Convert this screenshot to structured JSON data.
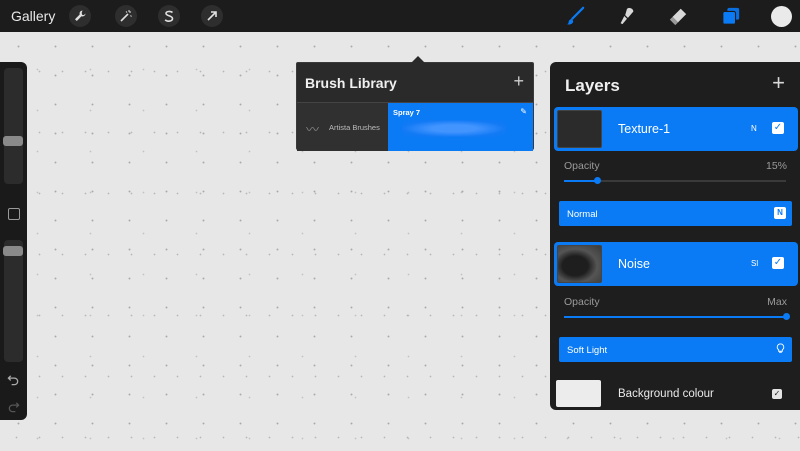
{
  "topbar": {
    "gallery_label": "Gallery",
    "left_actions": [
      "wrench-icon",
      "magic-wand-icon",
      "selection-s-icon",
      "transform-arrow-icon"
    ],
    "right_tools": [
      "brush-icon",
      "smudge-icon",
      "eraser-icon",
      "layers-icon"
    ],
    "active_tool": "brush",
    "current_color": "#eaeaea",
    "accent_color": "#0a7bf5"
  },
  "brush_library": {
    "title": "Brush Library",
    "brush_set": "Artista Brushes",
    "selected_brush": "Spray 7"
  },
  "layers_panel": {
    "title": "Layers",
    "layers": [
      {
        "name": "Texture-1",
        "mode_short": "N",
        "visible": true,
        "opacity_label": "Opacity",
        "opacity_value": "15%",
        "opacity_fraction": 0.15,
        "blend_mode": "Normal",
        "blend_icon": "N"
      },
      {
        "name": "Noise",
        "mode_short": "Sl",
        "visible": true,
        "opacity_label": "Opacity",
        "opacity_value": "Max",
        "opacity_fraction": 1.0,
        "blend_mode": "Soft Light",
        "blend_icon": "lightbulb-icon"
      }
    ],
    "background": {
      "name": "Background colour",
      "visible": true
    }
  }
}
